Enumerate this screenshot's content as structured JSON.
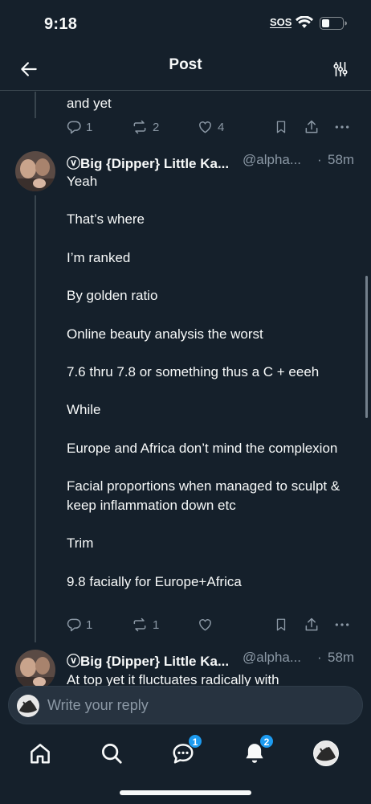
{
  "status_bar": {
    "time": "9:18",
    "sos": "SOS"
  },
  "header": {
    "title": "Post"
  },
  "prev_tweet": {
    "text_tail": "and yet",
    "actions": {
      "replies": "1",
      "reposts": "2",
      "likes": "4"
    }
  },
  "tweets": [
    {
      "display_name": "ⓥBig {Dipper} Little Ka...",
      "handle": "@alpha...",
      "time": "58m",
      "paragraphs": [
        "Yeah",
        "That’s where",
        "I’m ranked",
        "By golden ratio",
        "Online beauty analysis the worst",
        "7.6 thru 7.8 or something thus a C + eeeh",
        "While",
        "Europe and Africa don’t mind the complexion",
        "Facial proportions when managed to sculpt & keep inflammation down etc",
        "Trim",
        "9.8 facially for Europe+Africa"
      ],
      "actions": {
        "replies": "1",
        "reposts": "1",
        "likes": ""
      }
    },
    {
      "display_name": "ⓥBig {Dipper} Little Ka...",
      "handle": "@alpha...",
      "time": "58m",
      "text_partial": "At top yet it fluctuates radically with"
    }
  ],
  "reply_bar": {
    "placeholder": "Write your reply"
  },
  "bottom_nav": {
    "items": [
      "home",
      "search",
      "grok",
      "notifications",
      "profile"
    ],
    "badges": {
      "messages": "1",
      "notifications": "2"
    }
  },
  "time_separator": "·",
  "colors": {
    "background": "#15202b",
    "text": "#f7f9f9",
    "secondary": "#8b98a5",
    "accent": "#1d9bf0",
    "divider": "#38444d"
  },
  "icons": {
    "back": "arrow-left-icon",
    "settings": "sliders-icon",
    "reply": "reply-icon",
    "repost": "repost-icon",
    "like": "heart-icon",
    "bookmark": "bookmark-icon",
    "share": "share-icon",
    "more": "more-icon"
  }
}
